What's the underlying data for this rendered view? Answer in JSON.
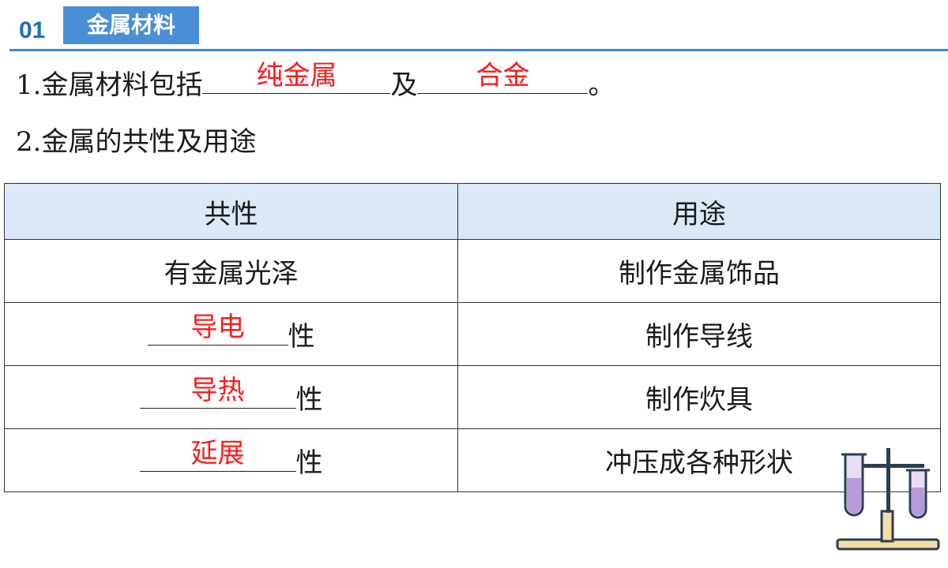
{
  "header": {
    "section_number": "01",
    "section_title": "金属材料"
  },
  "question1": {
    "prefix": "1.金属材料包括",
    "answer1": "纯金属",
    "middle": "及",
    "answer2": "合金",
    "suffix": "。"
  },
  "question2": {
    "text": "2.金属的共性及用途"
  },
  "table": {
    "headers": [
      "共性",
      "用途"
    ],
    "rows": [
      {
        "property": "有金属光泽",
        "use": "制作金属饰品"
      },
      {
        "answer": "导电",
        "suffix": "性",
        "use": "制作导线"
      },
      {
        "answer": "导热",
        "suffix": "性",
        "use": "制作炊具"
      },
      {
        "answer": "延展",
        "suffix": "性",
        "use": "冲压成各种形状"
      }
    ]
  },
  "colors": {
    "accent_blue": "#4a8fd6",
    "header_bg": "#dbe8f6",
    "answer_red": "#ff1a1a"
  },
  "decoration": {
    "icon": "test-tube-rack-icon"
  }
}
